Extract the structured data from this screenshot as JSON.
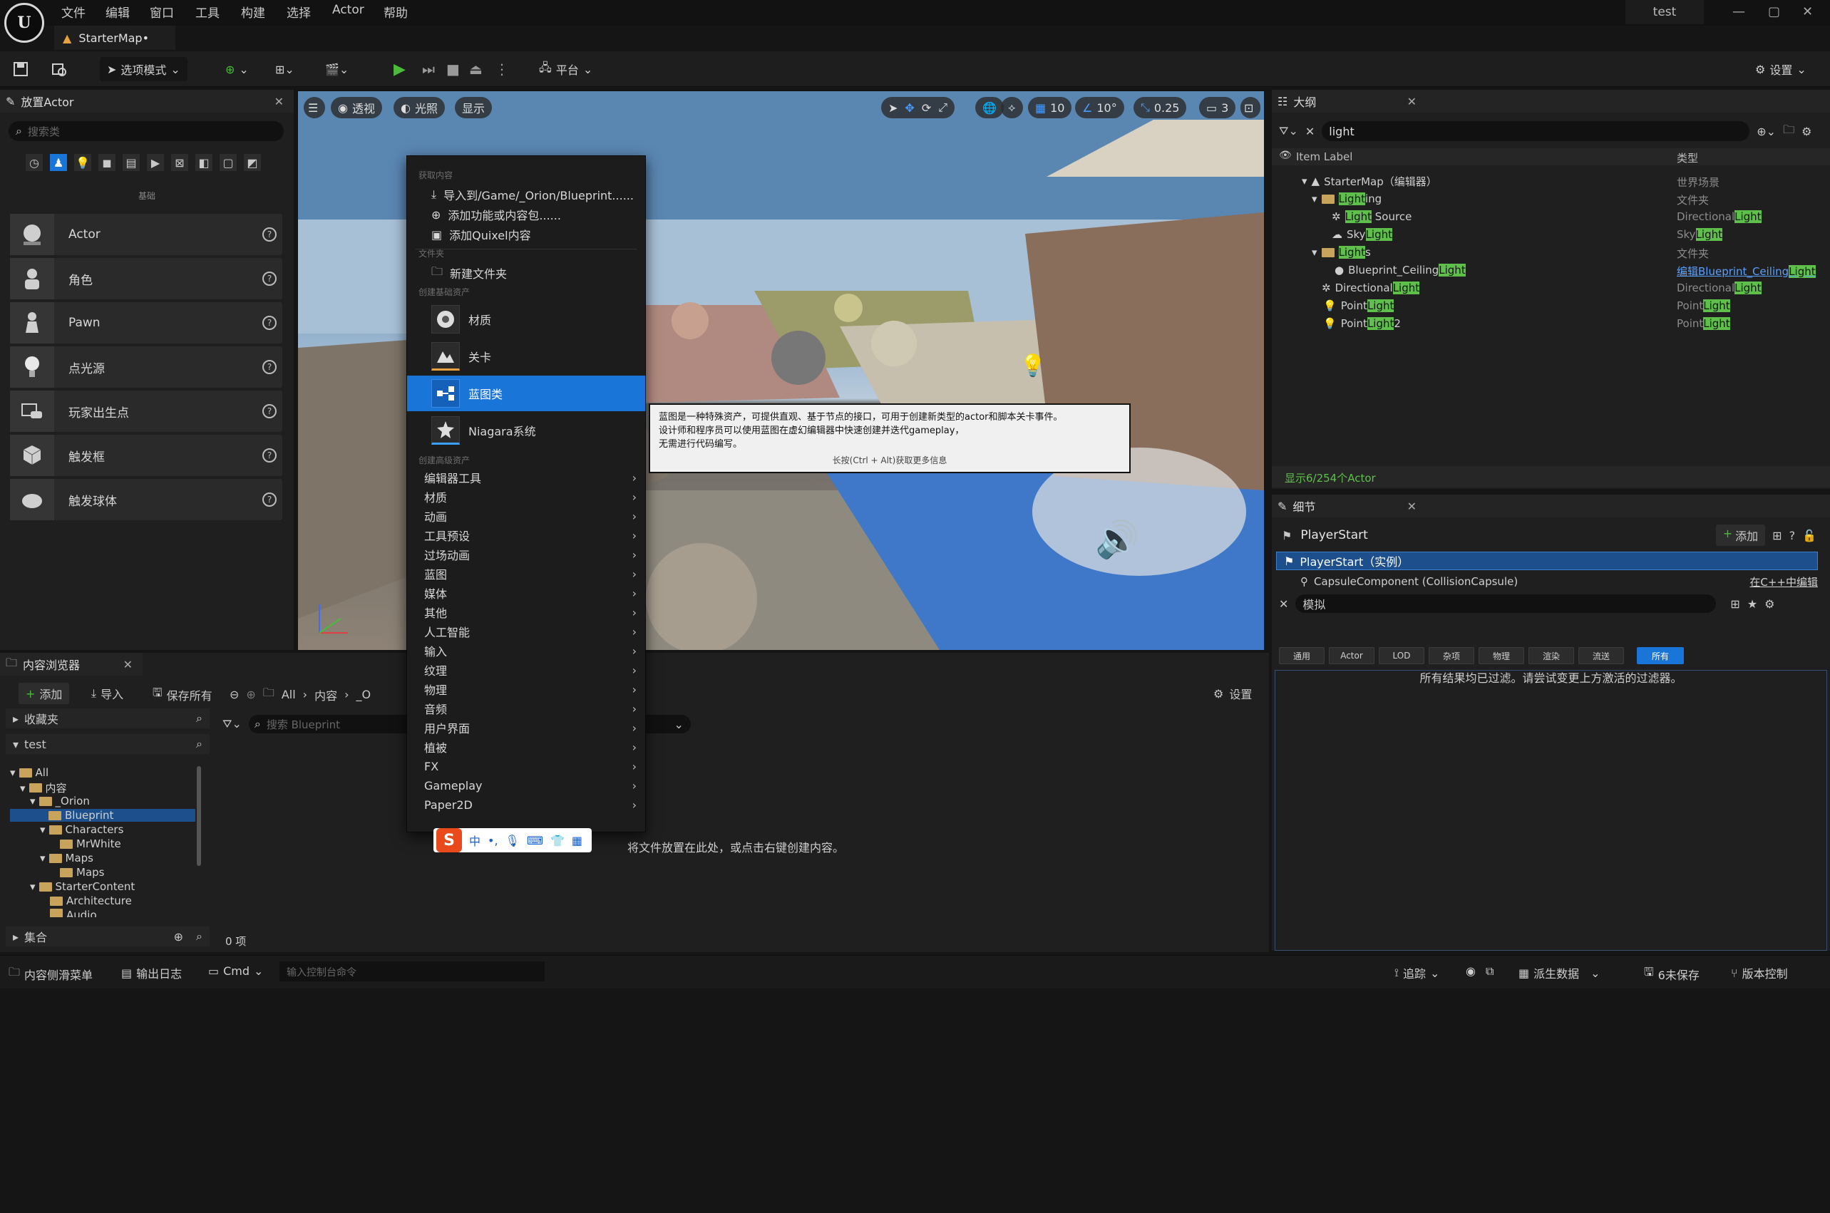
{
  "app": {
    "map_tab": "StarterMap•",
    "project": "test"
  },
  "menubar": [
    "文件",
    "编辑",
    "窗口",
    "工具",
    "构建",
    "选择",
    "Actor",
    "帮助"
  ],
  "toolbar": {
    "mode_label": "选项模式",
    "platform_label": "平台",
    "settings_label": "设置"
  },
  "place_actor": {
    "tab_title": "放置Actor",
    "search_placeholder": "搜索类",
    "category_label": "基础",
    "items": [
      "Actor",
      "角色",
      "Pawn",
      "点光源",
      "玩家出生点",
      "触发框",
      "触发球体"
    ]
  },
  "viewport": {
    "perspective_label": "透视",
    "lighting_label": "光照",
    "show_label": "显示",
    "grid_snap": "10",
    "rotation_snap": "10°",
    "scale_snap": "0.25",
    "camera_speed": "3"
  },
  "context_menu": {
    "section_get_content": "获取内容",
    "import_label": "导入到/Game/_Orion/Blueprint......",
    "add_feature_label": "添加功能或内容包......",
    "add_quixel_label": "添加Quixel内容",
    "section_folder": "文件夹",
    "new_folder_label": "新建文件夹",
    "section_basic_assets": "创建基础资产",
    "basic_assets": [
      "材质",
      "关卡",
      "蓝图类",
      "Niagara系统"
    ],
    "section_advanced_assets": "创建高级资产",
    "advanced_assets": [
      "编辑器工具",
      "材质",
      "动画",
      "工具预设",
      "过场动画",
      "蓝图",
      "媒体",
      "其他",
      "人工智能",
      "输入",
      "纹理",
      "物理",
      "音频",
      "用户界面",
      "植被",
      "FX",
      "Gameplay",
      "Paper2D"
    ]
  },
  "tooltip": {
    "line1": "蓝图是一种特殊资产，可提供直观、基于节点的接口，可用于创建新类型的actor和脚本关卡事件。",
    "line2": "设计师和程序员可以使用蓝图在虚幻编辑器中快速创建并迭代gameplay，",
    "line3": "无需进行代码编写。",
    "hint": "长按(Ctrl + Alt)获取更多信息"
  },
  "outliner": {
    "tab_title": "大纲",
    "search_value": "light",
    "col_label": "Item Label",
    "col_type": "类型",
    "count_text": "显示6/254个Actor",
    "rows": [
      {
        "pre": "StarterMap（编辑器）",
        "hl": "",
        "post": "",
        "type_pre": "世界场景",
        "type_hl": "",
        "type_post": ""
      },
      {
        "pre": "",
        "hl": "Light",
        "post": "ing",
        "type_pre": "文件夹",
        "type_hl": "",
        "type_post": ""
      },
      {
        "pre": "",
        "hl": "Light",
        "post": " Source",
        "type_pre": "Directional",
        "type_hl": "Light",
        "type_post": ""
      },
      {
        "pre": "Sky",
        "hl": "Light",
        "post": "",
        "type_pre": "Sky",
        "type_hl": "Light",
        "type_post": ""
      },
      {
        "pre": "",
        "hl": "Light",
        "post": "s",
        "type_pre": "文件夹",
        "type_hl": "",
        "type_post": ""
      },
      {
        "pre": "Blueprint_Ceiling",
        "hl": "Light",
        "post": "",
        "type_pre": "编辑Blueprint_Ceiling",
        "type_hl": "",
        "type_post": "Light"
      },
      {
        "pre": "Directional",
        "hl": "Light",
        "post": "",
        "type_pre": "Directional",
        "type_hl": "Light",
        "type_post": ""
      },
      {
        "pre": "Point",
        "hl": "Light",
        "post": "",
        "type_pre": "Point",
        "type_hl": "Light",
        "type_post": ""
      },
      {
        "pre": "Point",
        "hl": "Light",
        "post": "2",
        "type_pre": "Point",
        "type_hl": "Light",
        "type_post": ""
      }
    ]
  },
  "details": {
    "tab_title": "细节",
    "actor_name": "PlayerStart",
    "add_label": "添加",
    "instance_label": "PlayerStart（实例）",
    "component_label": "CapsuleComponent (CollisionCapsule)",
    "edit_cpp_label": "在C++中编辑",
    "search_value": "模拟",
    "filters": [
      "通用",
      "Actor",
      "LOD",
      "杂项",
      "物理",
      "渲染",
      "流送",
      "所有"
    ],
    "empty_text": "所有结果均已过滤。请尝试变更上方激活的过滤器。"
  },
  "content_browser": {
    "tab_title": "内容浏览器",
    "add_label": "添加",
    "import_label": "导入",
    "save_all_label": "保存所有",
    "path": [
      "All",
      "内容",
      "_O"
    ],
    "settings_label": "设置",
    "favorites_label": "收藏夹",
    "project_label": "test",
    "search_placeholder": "搜索 Blueprint",
    "tree": [
      "All",
      "内容",
      "_Orion",
      "Blueprint",
      "Characters",
      "MrWhite",
      "Maps",
      "Maps",
      "StarterContent",
      "Architecture",
      "Audio"
    ],
    "collections_label": "集合",
    "drop_hint": "将文件放置在此处，或点击右键创建内容。",
    "item_count": "0 项"
  },
  "ime": {
    "lang": "中"
  },
  "statusbar": {
    "drawer_label": "内容侧滑菜单",
    "output_log_label": "输出日志",
    "cmd_label": "Cmd",
    "console_placeholder": "输入控制台命令",
    "trace_label": "追踪",
    "derived_data_label": "派生数据",
    "unsaved_label": "6未保存",
    "source_control_label": "版本控制"
  },
  "colors": {
    "accent_blue": "#1a75d8",
    "highlight_green": "#5ec04a",
    "play_green": "#4cba3a"
  }
}
